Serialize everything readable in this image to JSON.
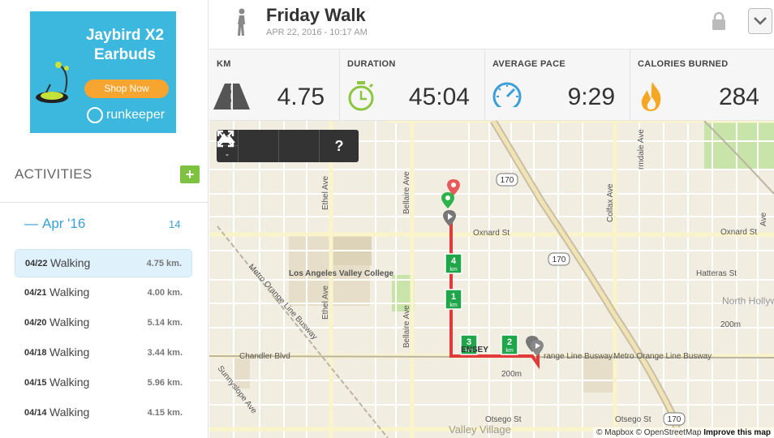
{
  "ad": {
    "title": "Jaybird X2 Earbuds",
    "cta": "Shop Now",
    "brand": "runkeeper"
  },
  "sidebar": {
    "heading": "ACTIVITIES",
    "add_label": "+",
    "month": {
      "label": "Apr '16",
      "count": "14",
      "toggle": "—"
    },
    "activities": [
      {
        "date": "04/22",
        "type": "Walking",
        "distance": "4.75 km."
      },
      {
        "date": "04/21",
        "type": "Walking",
        "distance": "4.00 km."
      },
      {
        "date": "04/20",
        "type": "Walking",
        "distance": "5.14 km."
      },
      {
        "date": "04/18",
        "type": "Walking",
        "distance": "3.44 km."
      },
      {
        "date": "04/15",
        "type": "Walking",
        "distance": "5.96 km."
      },
      {
        "date": "04/14",
        "type": "Walking",
        "distance": "4.15 km."
      }
    ]
  },
  "header": {
    "title": "Friday Walk",
    "subtitle": "APR 22, 2016  -  10:17 AM"
  },
  "stats": [
    {
      "label": "KM",
      "value": "4.75",
      "icon": "road-icon"
    },
    {
      "label": "DURATION",
      "value": "45:04",
      "icon": "stopwatch-icon"
    },
    {
      "label": "AVERAGE PACE",
      "value": "9:29",
      "icon": "speedometer-icon"
    },
    {
      "label": "CALORIES BURNED",
      "value": "284",
      "icon": "flame-icon"
    }
  ],
  "map": {
    "controls": {
      "zoom_in": "+",
      "zoom_out": "-",
      "help": "?"
    },
    "streets": {
      "ethel": "Ethel Ave",
      "bellaire": "Bellaire Ave",
      "oxnard_left": "Oxnard St",
      "oxnard_right": "Oxnard St",
      "colfax": "Colfax Ave",
      "hatteras": "Hatteras St",
      "chandler": "Chandler Blvd",
      "metro_line_busway": "Metro Orange Line Busway",
      "metro_left": "Metro Orange Line Busway",
      "metro_mid": "range Line Busway",
      "metro_right": "Metro Orange Line Busway",
      "sunnyslope": "Sunnyslope Ave",
      "otsego_left": "Otsego St",
      "otsego_right": "Otsego St",
      "valley_village": "Valley Village",
      "north_hollywood": "North Hollywood",
      "college": "Los Angeles Valley College",
      "dale": "rmdale Ave",
      "ave_right": "Ave",
      "highway": "170",
      "contour": "200m",
      "chandler_partial": "ENSEY"
    },
    "km_markers": [
      "4",
      "1",
      "3",
      "2"
    ],
    "km_unit": "km",
    "attribution": {
      "mapbox": "© Mapbox",
      "osm": "© OpenStreetMap",
      "improve": "Improve this map"
    }
  }
}
